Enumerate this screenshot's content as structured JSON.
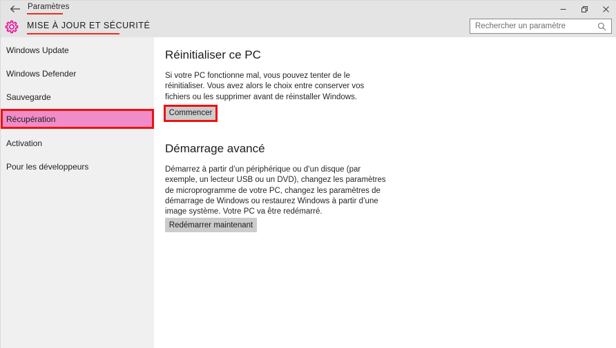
{
  "window": {
    "app_title": "Paramètres",
    "back_icon": "back-arrow-icon",
    "controls": {
      "minimize": "minimize-icon",
      "maximize": "restore-icon",
      "close": "close-icon"
    }
  },
  "header": {
    "gear_icon": "gear-icon",
    "page_title": "MISE À JOUR ET SÉCURITÉ",
    "accent_red": "#ef2b21",
    "accent_pink": "#f08cc8"
  },
  "search": {
    "placeholder": "Rechercher un paramètre",
    "value": "",
    "icon": "search-icon"
  },
  "sidebar": {
    "items": [
      {
        "label": "Windows Update",
        "selected": false
      },
      {
        "label": "Windows Defender",
        "selected": false
      },
      {
        "label": "Sauvegarde",
        "selected": false
      },
      {
        "label": "Récupération",
        "selected": true
      },
      {
        "label": "Activation",
        "selected": false
      },
      {
        "label": "Pour les développeurs",
        "selected": false
      }
    ]
  },
  "main": {
    "sections": [
      {
        "heading": "Réinitialiser ce PC",
        "body": "Si votre PC fonctionne mal, vous pouvez tenter de le réinitialiser. Vous avez alors le choix entre conserver vos fichiers ou les supprimer avant de réinstaller Windows.",
        "button": "Commencer"
      },
      {
        "heading": "Démarrage avancé",
        "body": "Démarrez à partir d’un périphérique ou d’un disque (par exemple, un lecteur USB ou un DVD), changez les paramètres de microprogramme de votre PC, changez les paramètres de démarrage de Windows ou restaurez Windows à partir d’une image système. Votre PC va être redémarré.",
        "button": "Redémarrer maintenant"
      }
    ]
  }
}
